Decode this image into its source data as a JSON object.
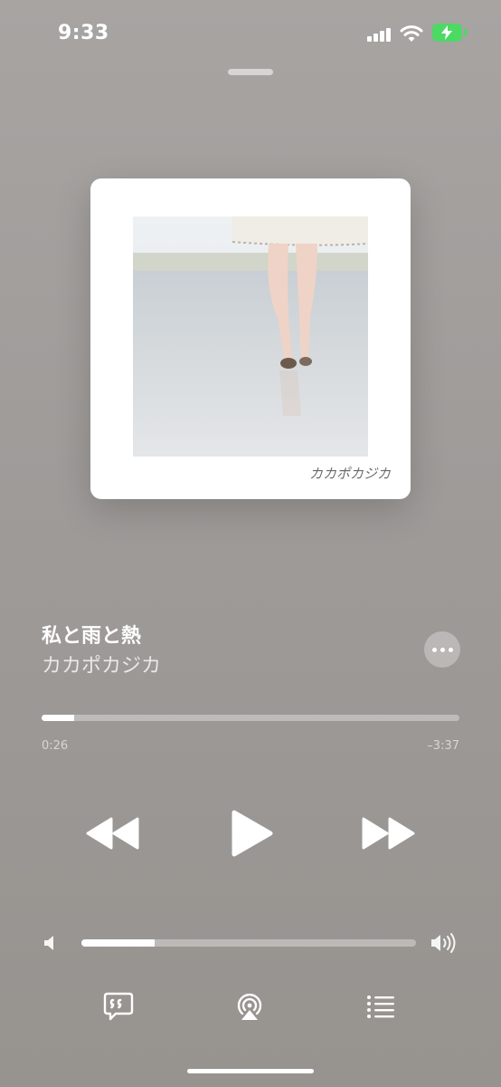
{
  "status_bar": {
    "time": "9:33",
    "icons": [
      "signal-icon",
      "wifi-icon",
      "battery-charging-icon"
    ],
    "battery_color": "#4cd964"
  },
  "artwork": {
    "art_text": "カカポカジカ"
  },
  "track": {
    "title": "私と雨と熱",
    "artist": "カカポカジカ"
  },
  "playback": {
    "elapsed": "0:26",
    "remaining": "–3:37",
    "progress_fraction": 0.077
  },
  "controls": {
    "icons": [
      "rewind-icon",
      "play-icon",
      "fast-forward-icon"
    ]
  },
  "volume": {
    "level_fraction": 0.22,
    "icons": [
      "volume-low-icon",
      "volume-high-icon"
    ]
  },
  "bottom_bar": {
    "icons": [
      "lyrics-icon",
      "airplay-icon",
      "queue-icon"
    ]
  }
}
